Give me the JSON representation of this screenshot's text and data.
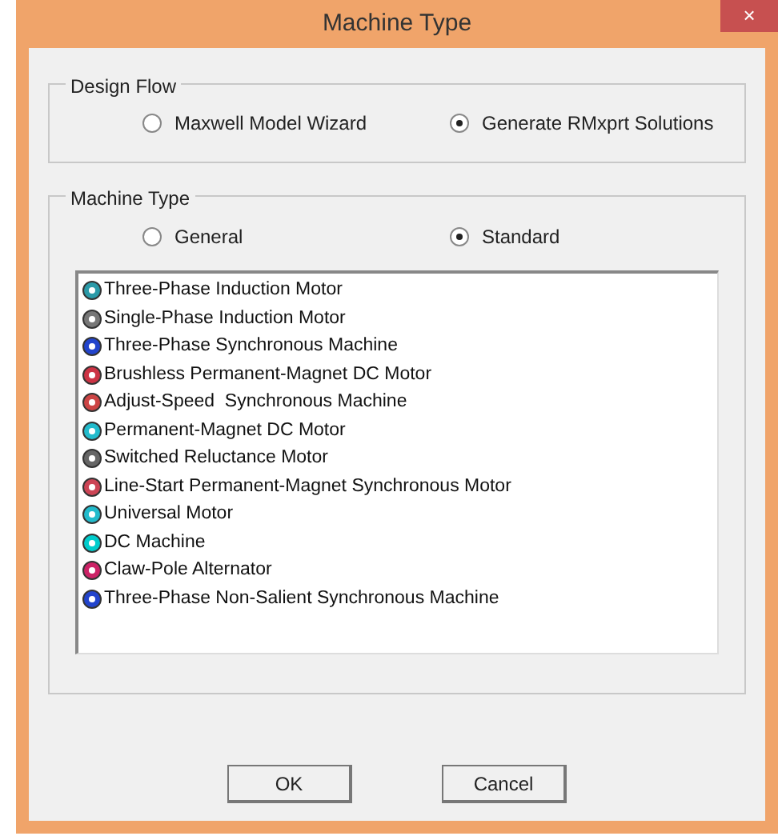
{
  "window": {
    "title": "Machine Type",
    "close": "×"
  },
  "design_flow": {
    "label": "Design Flow",
    "options": [
      {
        "label": "Maxwell Model Wizard",
        "selected": false
      },
      {
        "label": "Generate RMxprt Solutions",
        "selected": true
      }
    ]
  },
  "machine_type": {
    "label": "Machine Type",
    "options": [
      {
        "label": "General",
        "selected": false
      },
      {
        "label": "Standard",
        "selected": true
      }
    ],
    "items": [
      "Three-Phase Induction Motor",
      "Single-Phase Induction Motor",
      "Three-Phase Synchronous Machine",
      "Brushless Permanent-Magnet DC Motor",
      "Adjust-Speed  Synchronous Machine",
      "Permanent-Magnet DC Motor",
      "Switched Reluctance Motor",
      "Line-Start Permanent-Magnet Synchronous Motor",
      "Universal Motor",
      "DC Machine",
      "Claw-Pole Alternator",
      "Three-Phase Non-Salient Synchronous Machine"
    ]
  },
  "buttons": [
    "OK",
    "Cancel"
  ]
}
